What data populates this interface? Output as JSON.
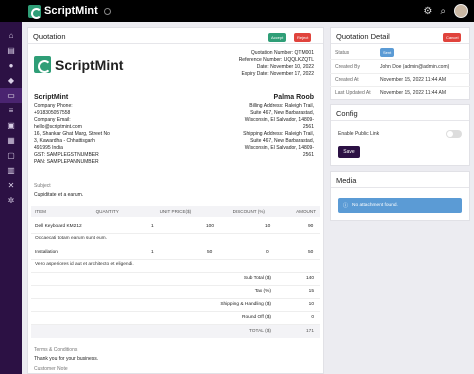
{
  "app": {
    "brand": "ScriptMint"
  },
  "quotation": {
    "title": "Quotation",
    "accept": "Accept",
    "reject": "Reject",
    "logo": "ScriptMint",
    "number_line": "Quotation Number: QTM001",
    "reference_line": "Reference Number: UQQLKZQTL",
    "date_line": "Date: November 10, 2022",
    "expiry_line": "Expiry Date: November 17, 2022",
    "company": {
      "name": "ScriptMint",
      "lines": [
        "Company Phone:",
        "+918305057558",
        "Company Email:",
        "hello@scriptmint.com",
        "16, Shankar Ghat Marg, Street No",
        "3, Kawardha - Chhattisgarh",
        "491995 India",
        "GST: SAMPLEGSTNUMBER",
        "PAN: SAMPLEPANNUMBER"
      ]
    },
    "customer": {
      "name": "Palma Roob",
      "billing": [
        "Billing Address: Raleigh Trail,",
        "Suite 467, New Barbarastad,",
        "Wisconsin, El Salvador, 14809-",
        "2561"
      ],
      "shipping": [
        "Shipping Address: Raleigh Trail,",
        "Suite 467, New Barbarastad,",
        "Wisconsin, El Salvador, 14809-",
        "2561"
      ]
    },
    "subject_label": "Subject",
    "subject": "Cupiditate et a earum.",
    "columns": [
      "ITEM",
      "QUANTITY",
      "UNIT PRICE($)",
      "DISCOUNT (%)",
      "AMOUNT"
    ],
    "items": [
      {
        "item": "Dell Keyboard KM212",
        "qty": "1",
        "price": "100",
        "discount": "10",
        "amount": "90",
        "desc": "Occaecati totam earum sunt eum."
      },
      {
        "item": "Installation",
        "qty": "1",
        "price": "50",
        "discount": "0",
        "amount": "50",
        "desc": "Vero asperiores id aut et architecto et eligendi."
      }
    ],
    "totals": [
      {
        "label": "Sub Total ($)",
        "value": "140"
      },
      {
        "label": "Tax (%)",
        "value": "15"
      },
      {
        "label": "Shipping & Handling ($)",
        "value": "10"
      },
      {
        "label": "Round Off ($)",
        "value": "0"
      },
      {
        "label": "TOTAL ($)",
        "value": "171"
      }
    ],
    "terms_label": "Terms & Conditions",
    "terms": "Thank you for your business.",
    "customer_note_label": "Customer Note"
  },
  "detail": {
    "title": "Quotation Detail",
    "cancel": "Cancel",
    "rows": [
      {
        "label": "Status",
        "value": "Sent"
      },
      {
        "label": "Created By",
        "value": "John Doe (admin@admin.com)"
      },
      {
        "label": "Created At",
        "value": "November 15, 2022 11:44 AM"
      },
      {
        "label": "Last Updated At",
        "value": "November 15, 2022 11:44 AM"
      }
    ]
  },
  "config": {
    "title": "Config",
    "public_link": "Enable Public Link",
    "save": "Save"
  },
  "media": {
    "title": "Media",
    "empty": "No attachment found."
  },
  "colors": {
    "topbar": "#000000",
    "sidebar": "#2c1144",
    "accent": "#2f9e77",
    "accept": "#2f9e77",
    "reject": "#e0433c",
    "sent": "#5b9bd5",
    "save": "#2c1144",
    "info": "#5b9bd5"
  },
  "icons": [
    "home-icon",
    "folder-icon",
    "user-icon",
    "users-icon",
    "card-icon",
    "list-icon",
    "box-icon",
    "wallet-icon",
    "calendar-icon",
    "contacts-icon",
    "tools-icon",
    "gear-icon",
    "settings-icon",
    "search-icon",
    "avatar"
  ]
}
